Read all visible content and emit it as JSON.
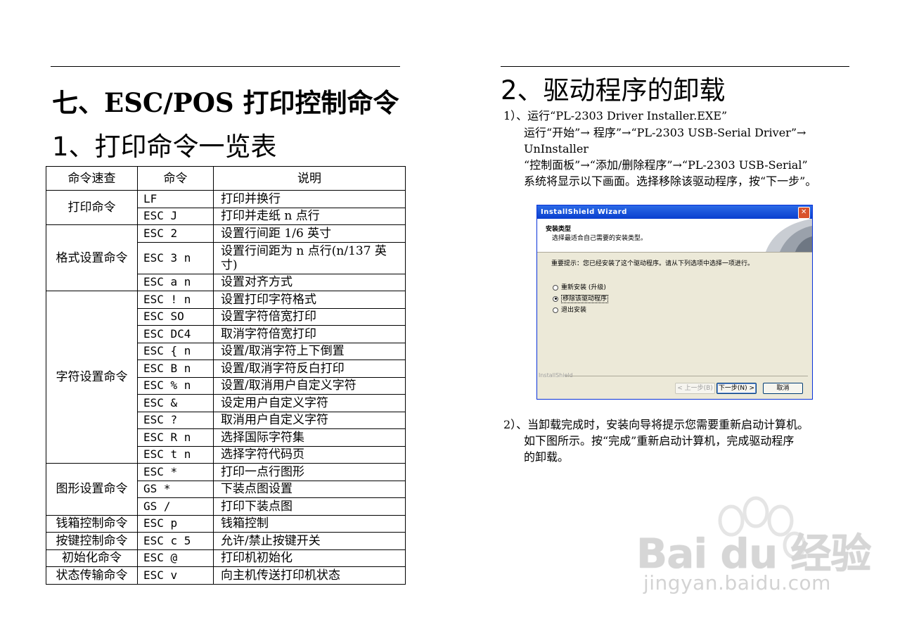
{
  "left": {
    "title": "七、ESC/POS 打印控制命令",
    "subtitle": "1、打印命令一览表",
    "table": {
      "headers": [
        "命令速查",
        "命令",
        "说明"
      ],
      "groups": [
        {
          "category": "打印命令",
          "rows": [
            [
              "LF",
              "打印并换行"
            ],
            [
              "ESC J",
              "打印并走纸 n 点行"
            ]
          ]
        },
        {
          "category": "格式设置命令",
          "rows": [
            [
              "ESC 2",
              "设置行间距 1/6 英寸"
            ],
            [
              "ESC 3 n",
              "设置行间距为 n 点行(n/137 英寸)"
            ],
            [
              "ESC a n",
              "设置对齐方式"
            ]
          ]
        },
        {
          "category": "字符设置命令",
          "rows": [
            [
              "ESC ! n",
              "设置打印字符格式"
            ],
            [
              "ESC SO",
              "设置字符倍宽打印"
            ],
            [
              "ESC DC4",
              "取消字符倍宽打印"
            ],
            [
              "ESC { n",
              "设置/取消字符上下倒置"
            ],
            [
              "ESC B n",
              "设置/取消字符反白打印"
            ],
            [
              "ESC % n",
              "设置/取消用户自定义字符"
            ],
            [
              "ESC &",
              "设定用户自定义字符"
            ],
            [
              "ESC ?",
              "取消用户自定义字符"
            ],
            [
              "ESC R n",
              "选择国际字符集"
            ],
            [
              "ESC t n",
              "选择字符代码页"
            ]
          ]
        },
        {
          "category": "图形设置命令",
          "rows": [
            [
              "ESC *",
              "打印一点行图形"
            ],
            [
              "GS *",
              "下装点图设置"
            ],
            [
              "GS /",
              "打印下装点图"
            ]
          ]
        },
        {
          "category": "钱箱控制命令",
          "rows": [
            [
              "ESC p",
              "钱箱控制"
            ]
          ]
        },
        {
          "category": "按键控制命令",
          "rows": [
            [
              "ESC c 5",
              "允许/禁止按键开关"
            ]
          ]
        },
        {
          "category": "初始化命令",
          "rows": [
            [
              "ESC @",
              "打印机初始化"
            ]
          ]
        },
        {
          "category": "状态传输命令",
          "rows": [
            [
              "ESC v",
              "向主机传送打印机状态"
            ]
          ]
        }
      ]
    }
  },
  "right": {
    "title": "2、驱动程序的卸载",
    "step1": {
      "line1": "1）、运行“PL-2303 Driver Installer.EXE”",
      "line2": "运行“开始”→ 程序”→“PL-2303 USB-Serial Driver”→",
      "line3": "UnInstaller",
      "line4": "“控制面板”→“添加/删除程序”→“PL-2303 USB-Serial”",
      "line5": "系统将显示以下画面。选择移除该驱动程序，按“下一步”。"
    },
    "dialog": {
      "title": "InstallShield Wizard",
      "close": "✕",
      "header_title": "安装类型",
      "header_sub": "选择最适合自己需要的安装类型。",
      "notice": "重要提示：您已经安装了这个驱动程序。请从下列选项中选择一项进行。",
      "options": [
        "重新安装 (升级)",
        "移除该驱动程序",
        "退出安装"
      ],
      "selected_index": 1,
      "brand": "InstallShield",
      "back": "< 上一步(B)",
      "next": "下一步(N) >",
      "cancel": "取消"
    },
    "step2": {
      "line1": "2）、当卸载完成时，安装向导将提示您需要重新启动计算机。",
      "line2": "如下图所示。按“完成”重新启动计算机，完成驱动程序",
      "line3": "的卸载。"
    }
  },
  "watermark": {
    "logo": "Bai du 经验",
    "url": "jingyan.baidu.com"
  }
}
